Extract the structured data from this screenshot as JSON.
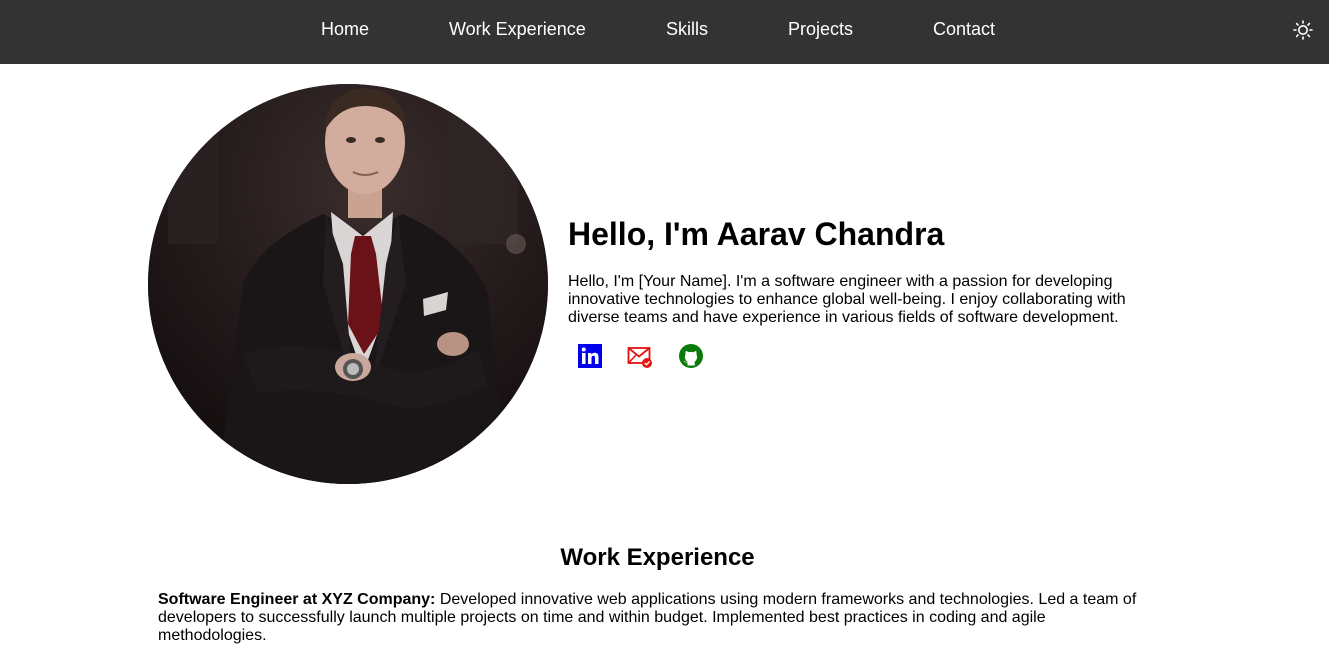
{
  "nav": {
    "links": [
      "Home",
      "Work Experience",
      "Skills",
      "Projects",
      "Contact"
    ],
    "theme_icon": "sun-icon"
  },
  "hero": {
    "photo_icon": "profile-photo",
    "title": "Hello, I'm Aarav Chandra",
    "bio": "Hello, I'm [Your Name]. I'm a software engineer with a passion for developing innovative technologies to enhance global well-being. I enjoy collaborating with diverse teams and have experience in various fields of software development.",
    "social": [
      {
        "icon": "linkedin-icon",
        "color": "#0000ee"
      },
      {
        "icon": "email-icon",
        "color": "#e81010"
      },
      {
        "icon": "github-icon",
        "color": "#0a7a0a"
      }
    ]
  },
  "work": {
    "heading": "Work Experience",
    "jobs": [
      {
        "title": "Software Engineer at XYZ Company:",
        "description": "Developed innovative web applications using modern frameworks and technologies. Led a team of developers to successfully launch multiple projects on time and within budget. Implemented best practices in coding and agile methodologies."
      }
    ]
  },
  "colors": {
    "navbar": "#333333",
    "nav_text": "#ffffff",
    "background": "#ffffff"
  }
}
